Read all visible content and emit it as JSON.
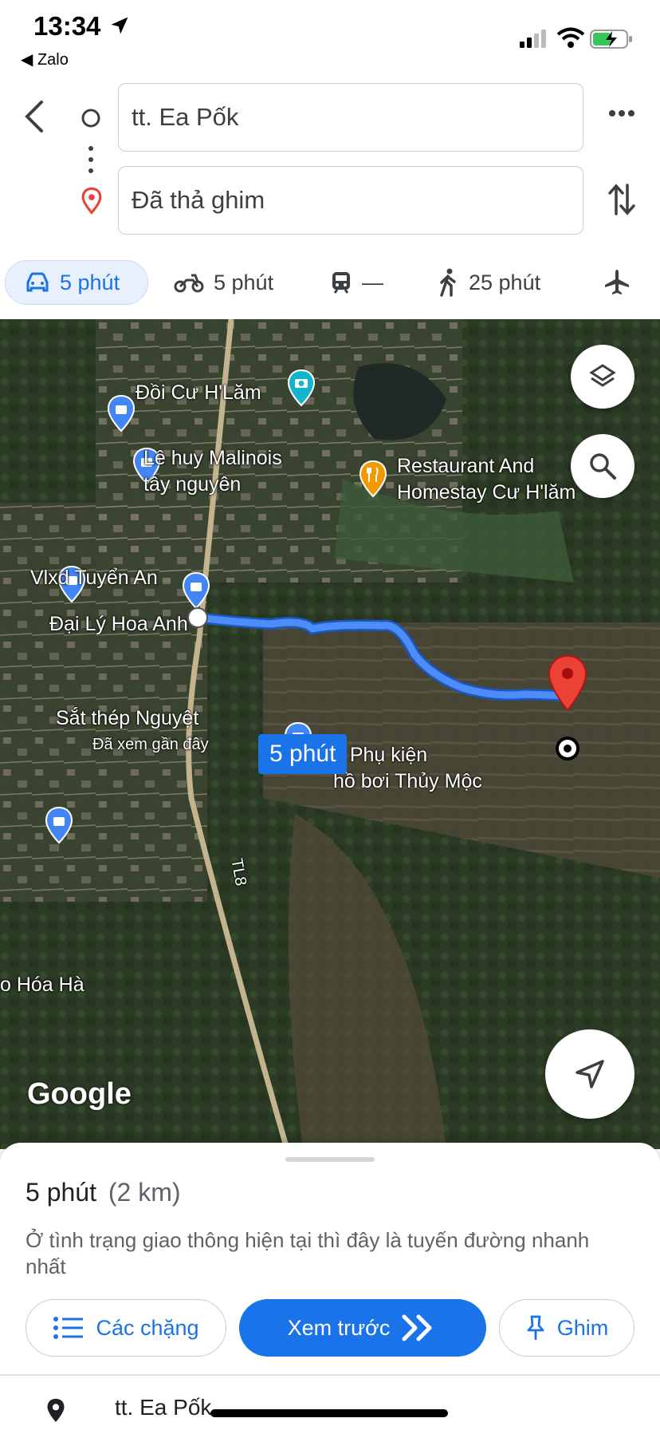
{
  "status_bar": {
    "time": "13:34",
    "back_app": "Zalo"
  },
  "route": {
    "origin": "tt. Ea Pốk",
    "destination": "Đã thả ghim"
  },
  "modes": [
    {
      "name": "car",
      "label": "5 phút"
    },
    {
      "name": "motorbike",
      "label": "5 phút"
    },
    {
      "name": "transit",
      "label": "—"
    },
    {
      "name": "walk",
      "label": "25 phút"
    },
    {
      "name": "flight",
      "label": ""
    }
  ],
  "map": {
    "labels": {
      "doi": "Đồi Cư H'Lăm",
      "malinois1": "Lê huy Malinois",
      "malinois2": "tây nguyên",
      "restaurant1": "Restaurant And",
      "restaurant2": "Homestay Cư H'lăm",
      "vlxd": "Vlxd Tuyển An",
      "daily": "Đại Lý Hoa Anh",
      "satthep": "Sắt thép Nguyệt",
      "daxem": "Đã xem gần đây",
      "phukien1": "g Phụ kiện",
      "phukien2": "hồ bơi Thủy Mộc",
      "hoaha": "o Hóa Hà",
      "road": "TL8"
    },
    "route_badge": "5 phút",
    "google": "Google"
  },
  "sheet": {
    "duration": "5 phút",
    "distance": "(2 km)",
    "description": "Ở tình trạng giao thông hiện tại thì đây là tuyến đường nhanh nhất",
    "steps_button": "Các chặng",
    "preview_button": "Xem trước",
    "pin_button": "Ghim",
    "first_step": "tt. Ea Pốk"
  },
  "colors": {
    "accent": "#1a73e8",
    "route": "#4e8cf7",
    "pin": "#ea4335"
  }
}
